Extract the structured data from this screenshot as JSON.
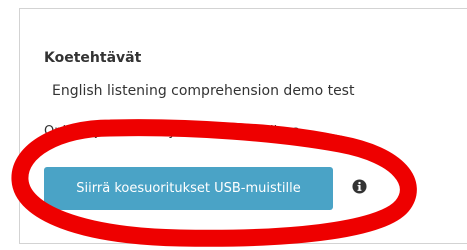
{
  "panel": {
    "title": "Koetehtävät",
    "exam_name": "English listening comprehension demo test",
    "instructions": "Opiskelijat voivat nyt siirtyä kokeisiinsa."
  },
  "actions": {
    "usb_button_label": "Siirrä koesuoritukset USB-muistille",
    "info_icon": "info-circle-icon"
  },
  "annotation": {
    "stroke_color": "#ee0000"
  },
  "colors": {
    "button_bg": "#4aa3c6",
    "button_text": "#ffffff",
    "info_icon": "#333333"
  }
}
